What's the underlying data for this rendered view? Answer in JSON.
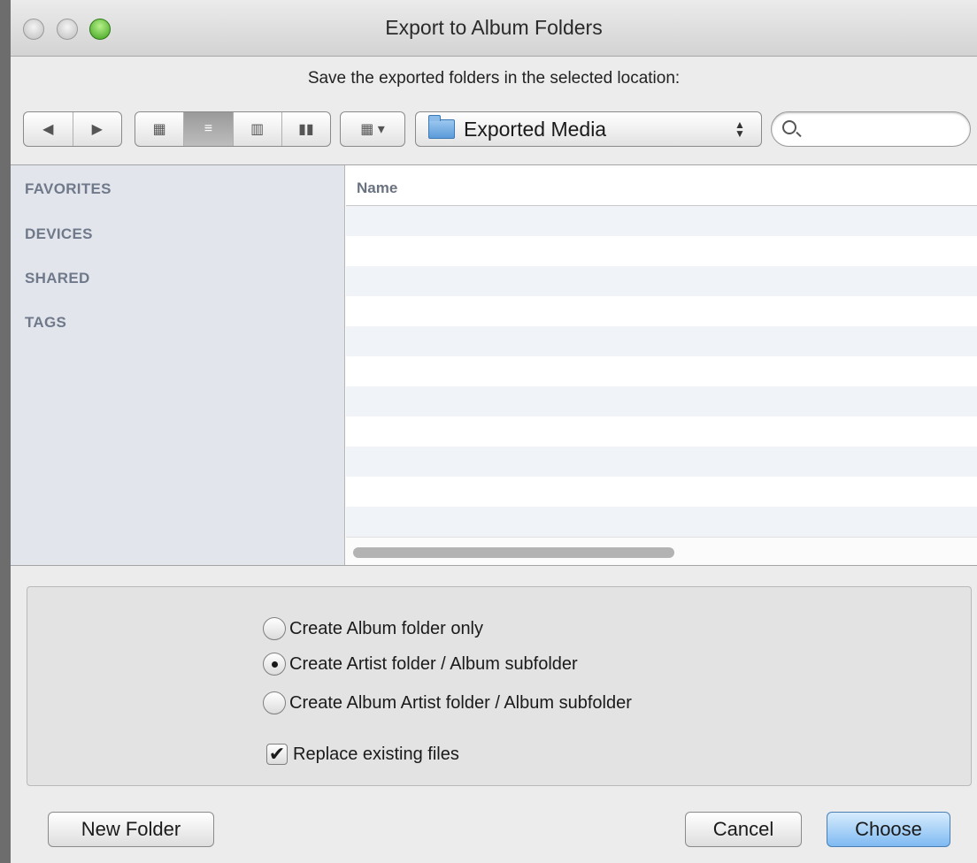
{
  "window": {
    "title": "Export to Album Folders"
  },
  "prompt": "Save the exported folders in the selected location:",
  "toolbar": {
    "nav": {
      "back_icon": "◀",
      "forward_icon": "▶"
    },
    "views": {
      "icon_view": "▦",
      "list_view": "≡",
      "column_view": "▥",
      "coverflow_view": "▮▮"
    },
    "arrange_icon": "▦ ▾",
    "location": "Exported Media",
    "search": {
      "placeholder": ""
    }
  },
  "sidebar": {
    "sections": [
      "FAVORITES",
      "DEVICES",
      "SHARED",
      "TAGS"
    ]
  },
  "list": {
    "column_name": "Name"
  },
  "options": {
    "radios": [
      {
        "label": "Create Album folder only",
        "selected": false
      },
      {
        "label": "Create Artist folder / Album subfolder",
        "selected": true
      },
      {
        "label": "Create Album Artist folder / Album subfolder",
        "selected": false
      }
    ],
    "replace_existing": {
      "label": "Replace existing files",
      "checked": true
    }
  },
  "buttons": {
    "new_folder": "New Folder",
    "cancel": "Cancel",
    "choose": "Choose"
  },
  "colors": {
    "primary_button": "#7fbaf2",
    "sidebar_bg": "#e2e6ec",
    "sidebar_heading": "#70798a"
  }
}
